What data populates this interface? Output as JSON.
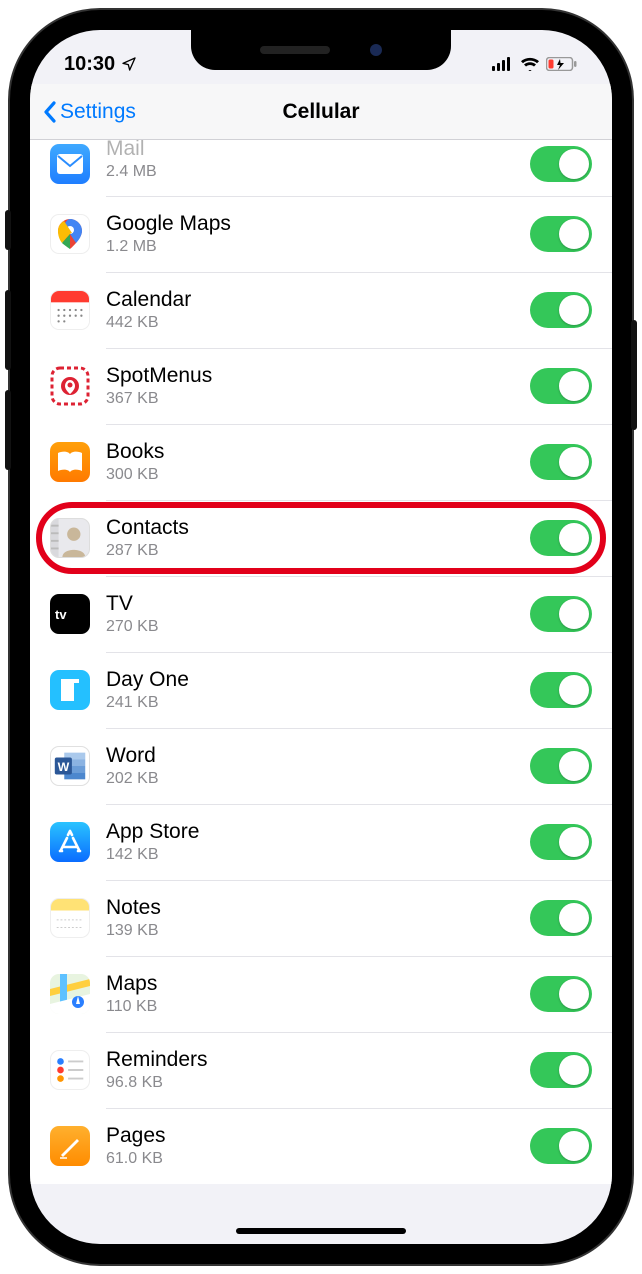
{
  "status": {
    "time": "10:30",
    "location_arrow": true
  },
  "nav": {
    "back_label": "Settings",
    "title": "Cellular"
  },
  "apps": [
    {
      "name": "Mail",
      "name_override": "Mail",
      "usage": "2.4 MB",
      "icon": "mail",
      "toggle": true,
      "partial_top": true
    },
    {
      "name": "Google Maps",
      "usage": "1.2 MB",
      "icon": "gmaps",
      "toggle": true
    },
    {
      "name": "Calendar",
      "usage": "442 KB",
      "icon": "calendar",
      "toggle": true
    },
    {
      "name": "SpotMenus",
      "usage": "367 KB",
      "icon": "spotmenus",
      "toggle": true
    },
    {
      "name": "Books",
      "usage": "300 KB",
      "icon": "books",
      "toggle": true
    },
    {
      "name": "Contacts",
      "usage": "287 KB",
      "icon": "contacts",
      "toggle": true,
      "highlighted": true
    },
    {
      "name": "TV",
      "usage": "270 KB",
      "icon": "tv",
      "toggle": true
    },
    {
      "name": "Day One",
      "usage": "241 KB",
      "icon": "dayone",
      "toggle": true
    },
    {
      "name": "Word",
      "usage": "202 KB",
      "icon": "word",
      "toggle": true
    },
    {
      "name": "App Store",
      "usage": "142 KB",
      "icon": "appstore",
      "toggle": true
    },
    {
      "name": "Notes",
      "usage": "139 KB",
      "icon": "notes",
      "toggle": true
    },
    {
      "name": "Maps",
      "usage": "110 KB",
      "icon": "maps",
      "toggle": true
    },
    {
      "name": "Reminders",
      "usage": "96.8 KB",
      "icon": "reminders",
      "toggle": true
    },
    {
      "name": "Pages",
      "usage": "61.0 KB",
      "icon": "pages",
      "toggle": true
    }
  ],
  "colors": {
    "accent": "#007aff",
    "toggle_on": "#34c759",
    "highlight": "#e2001a"
  }
}
